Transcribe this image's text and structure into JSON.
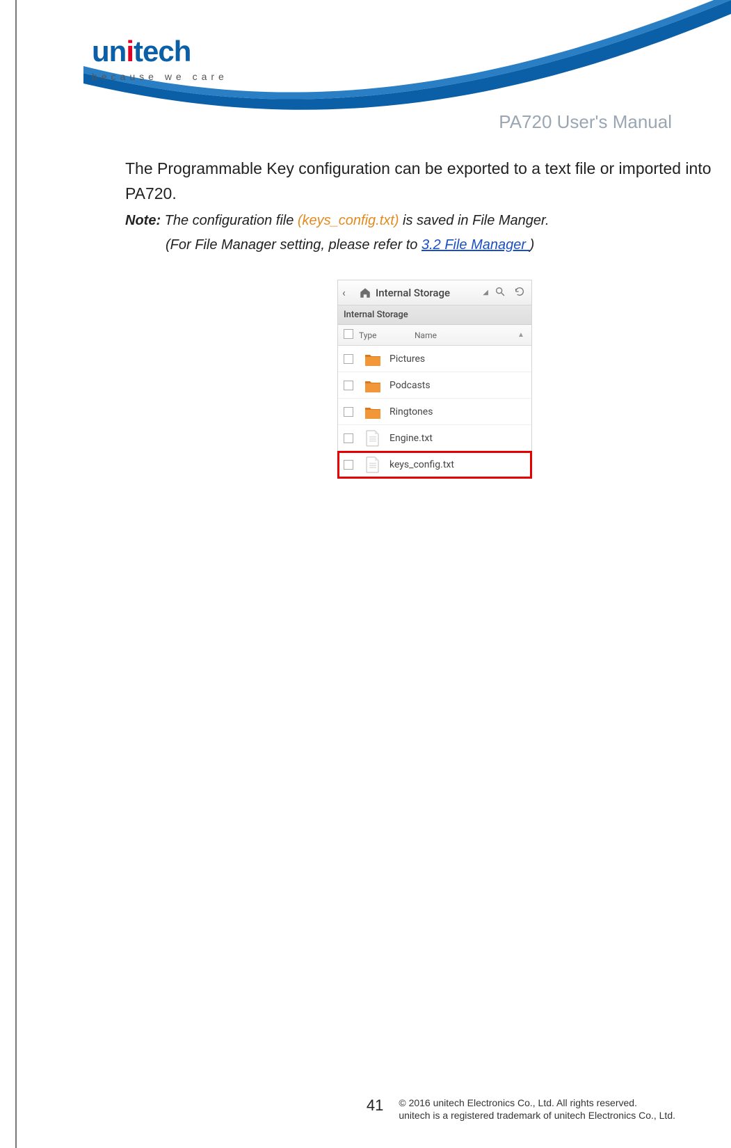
{
  "logo": {
    "brand_a": "un",
    "brand_b": "tech",
    "dot": "i",
    "tagline": "because we care"
  },
  "doc_title": "PA720 User's Manual",
  "body": {
    "para": "The Programmable Key configuration can be exported to a text file or imported into PA720.",
    "note_label": "Note:",
    "note_text_a": " The configuration file ",
    "note_file": "(keys_config.txt)",
    "note_text_b": " is saved in File Manger.",
    "note2_a": "(For File Manager setting, please refer to ",
    "note2_link": "3.2 File Manager ",
    "note2_b": ")"
  },
  "fm": {
    "title": "Internal Storage",
    "crumb": "Internal Storage",
    "col_type": "Type",
    "col_name": "Name",
    "rows": [
      {
        "kind": "folder",
        "name": "Pictures",
        "highlight": false
      },
      {
        "kind": "folder",
        "name": "Podcasts",
        "highlight": false
      },
      {
        "kind": "folder",
        "name": "Ringtones",
        "highlight": false
      },
      {
        "kind": "file",
        "name": "Engine.txt",
        "highlight": false
      },
      {
        "kind": "file",
        "name": "keys_config.txt",
        "highlight": true
      }
    ]
  },
  "footer": {
    "page": "41",
    "legal1": "© 2016 unitech Electronics Co., Ltd. All rights reserved.",
    "legal2": "unitech is a registered trademark of unitech Electronics Co., Ltd."
  }
}
